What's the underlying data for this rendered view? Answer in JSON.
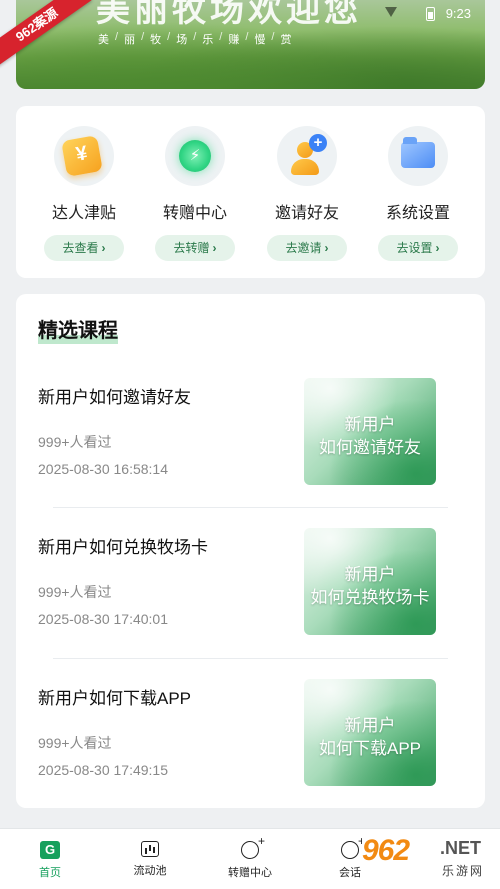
{
  "status": {
    "time": "9:23"
  },
  "watermark": "962案源",
  "banner": {
    "title": "美丽牧场欢迎您",
    "subtitle": [
      "美",
      "丽",
      "牧",
      "场",
      "乐",
      "赚",
      "慢",
      "赏"
    ]
  },
  "quick": [
    {
      "label": "达人津贴",
      "button": "去查看",
      "icon": "coin-bag-icon"
    },
    {
      "label": "转赠中心",
      "button": "去转赠",
      "icon": "lightning-icon"
    },
    {
      "label": "邀请好友",
      "button": "去邀请",
      "icon": "add-user-icon"
    },
    {
      "label": "系统设置",
      "button": "去设置",
      "icon": "folder-icon"
    }
  ],
  "courses": {
    "title": "精选课程",
    "items": [
      {
        "title": "新用户如何邀请好友",
        "views": "999+人看过",
        "date": "2025-08-30 16:58:14",
        "thumb": [
          "新用户",
          "如何邀请好友"
        ]
      },
      {
        "title": "新用户如何兑换牧场卡",
        "views": "999+人看过",
        "date": "2025-08-30 17:40:01",
        "thumb": [
          "新用户",
          "如何兑换牧场卡"
        ]
      },
      {
        "title": "新用户如何下载APP",
        "views": "999+人看过",
        "date": "2025-08-30 17:49:15",
        "thumb": [
          "新用户",
          "如何下载APP"
        ]
      }
    ]
  },
  "nav": [
    {
      "label": "首页",
      "icon": "home-icon",
      "active": true
    },
    {
      "label": "流动池",
      "icon": "chart-icon"
    },
    {
      "label": "转赠中心",
      "icon": "chat-plus-icon"
    },
    {
      "label": "会话",
      "icon": "chat-icon"
    }
  ],
  "logo": {
    "main": "962",
    "net": ".NET",
    "sub": "乐游网"
  },
  "colors": {
    "accent": "#16a05d",
    "button_bg": "#e5f3ea",
    "ribbon": "#d7232d"
  }
}
